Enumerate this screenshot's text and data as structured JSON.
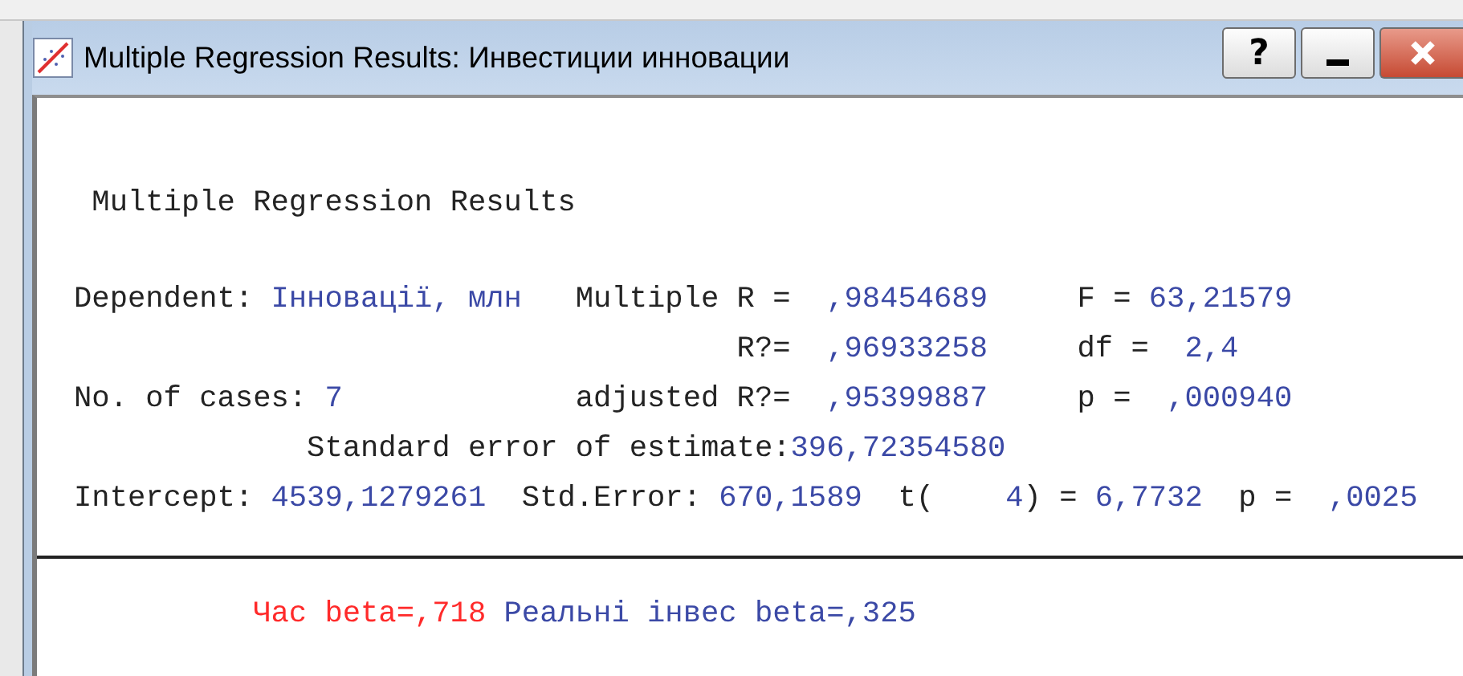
{
  "window": {
    "title": "Multiple Regression Results: Инвестиции инновации"
  },
  "title_buttons": [
    {
      "kind": "help",
      "label": "?"
    },
    {
      "kind": "minimize"
    },
    {
      "kind": "close"
    }
  ],
  "results": {
    "heading": "Multiple Regression Results",
    "rows": [
      [
        {
          "text": "Dependent:",
          "kind": "label"
        },
        {
          "text": "Інновації, млн",
          "kind": "value"
        },
        {
          "text": "Multiple R =",
          "kind": "label"
        },
        {
          "text": ",98454689",
          "kind": "value"
        },
        {
          "text": "F =",
          "kind": "label"
        },
        {
          "text": "63,21579",
          "kind": "value"
        }
      ],
      [
        {
          "text": ""
        },
        {
          "text": ""
        },
        {
          "text": "R?=",
          "kind": "label"
        },
        {
          "text": ",96933258",
          "kind": "value"
        },
        {
          "text": "df =",
          "kind": "label"
        },
        {
          "text": "2,4",
          "kind": "value"
        }
      ],
      [
        {
          "text": "No. of cases:",
          "kind": "label"
        },
        {
          "text": "7",
          "kind": "value"
        },
        {
          "text": "adjusted R?=",
          "kind": "label"
        },
        {
          "text": ",95399887",
          "kind": "value"
        },
        {
          "text": "p =",
          "kind": "label"
        },
        {
          "text": ",000940",
          "kind": "value"
        }
      ],
      [
        {
          "text": ""
        },
        {
          "text": "Standard error of estimate:",
          "kind": "label"
        },
        {
          "text": ""
        },
        {
          "text": "396,72354580",
          "kind": "value"
        }
      ]
    ],
    "intercept_line": [
      {
        "text": "Intercept:",
        "kind": "label"
      },
      {
        "text": "4539,1279261",
        "kind": "value"
      },
      {
        "text": "Std.Error:",
        "kind": "label"
      },
      {
        "text": "670,1589",
        "kind": "value"
      },
      {
        "text": "t(",
        "kind": "label"
      },
      {
        "text": "4",
        "kind": "value"
      },
      {
        "text": ") =",
        "kind": "label"
      },
      {
        "text": "6,7732",
        "kind": "value"
      },
      {
        "text": "p =",
        "kind": "label"
      },
      {
        "text": ",0025",
        "kind": "value"
      }
    ]
  },
  "betas": [
    {
      "text": "Час beta=,718",
      "color": "#ff2a2a"
    },
    {
      "text": "Реальні інвес beta=,325",
      "color": "#3b49a6"
    }
  ]
}
